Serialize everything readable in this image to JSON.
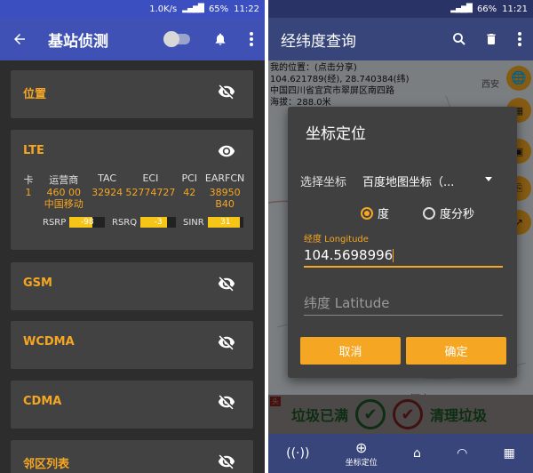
{
  "left": {
    "status": {
      "net": "1.0K/s",
      "signal": "4G",
      "battery": "65%",
      "time": "11:22"
    },
    "toolbar": {
      "title": "基站侦测"
    },
    "cards": [
      {
        "label": "位置",
        "visible": false
      },
      {
        "label": "LTE",
        "visible": true
      },
      {
        "label": "GSM",
        "visible": false
      },
      {
        "label": "WCDMA",
        "visible": false
      },
      {
        "label": "CDMA",
        "visible": false
      },
      {
        "label": "邻区列表",
        "visible": false
      }
    ],
    "lte": {
      "headers": [
        "卡",
        "运营商",
        "TAC",
        "ECI",
        "PCI",
        "EARFCN"
      ],
      "values": [
        "1",
        "460 00",
        "32924",
        "52774727",
        "42",
        "38950"
      ],
      "operator_name": "中国移动",
      "band": "B40",
      "meters": [
        {
          "label": "RSRP",
          "value": "-98",
          "level": 0.65
        },
        {
          "label": "RSRQ",
          "value": "-3",
          "level": 0.75
        },
        {
          "label": "SINR",
          "value": "31",
          "level": 0.9
        }
      ]
    }
  },
  "right": {
    "status": {
      "battery": "66%",
      "time": "11:21"
    },
    "toolbar": {
      "title": "经纬度查询"
    },
    "map": {
      "location_label": "我的位置：(点击分享)",
      "coords": "104.621789(经), 28.740384(纬)",
      "address": "中国四川省宜宾市翠屏区南四路",
      "altitude": "海拔：288.0米",
      "place": "西安",
      "river": "河内"
    },
    "dialog": {
      "title": "坐标定位",
      "select_label": "选择坐标",
      "select_value": "百度地图坐标（...",
      "radio_degree": "度",
      "radio_dms": "度分秒",
      "lng_label": "经度 Longitude",
      "lng_value": "104.5698996",
      "lat_placeholder": "纬度 Latitude",
      "cancel": "取消",
      "ok": "确定"
    },
    "ad": {
      "left": "垃圾已满",
      "right": "清理垃圾"
    },
    "bottom_nav": [
      {
        "label": ""
      },
      {
        "label": "坐标定位"
      },
      {
        "label": ""
      },
      {
        "label": ""
      },
      {
        "label": ""
      }
    ]
  }
}
